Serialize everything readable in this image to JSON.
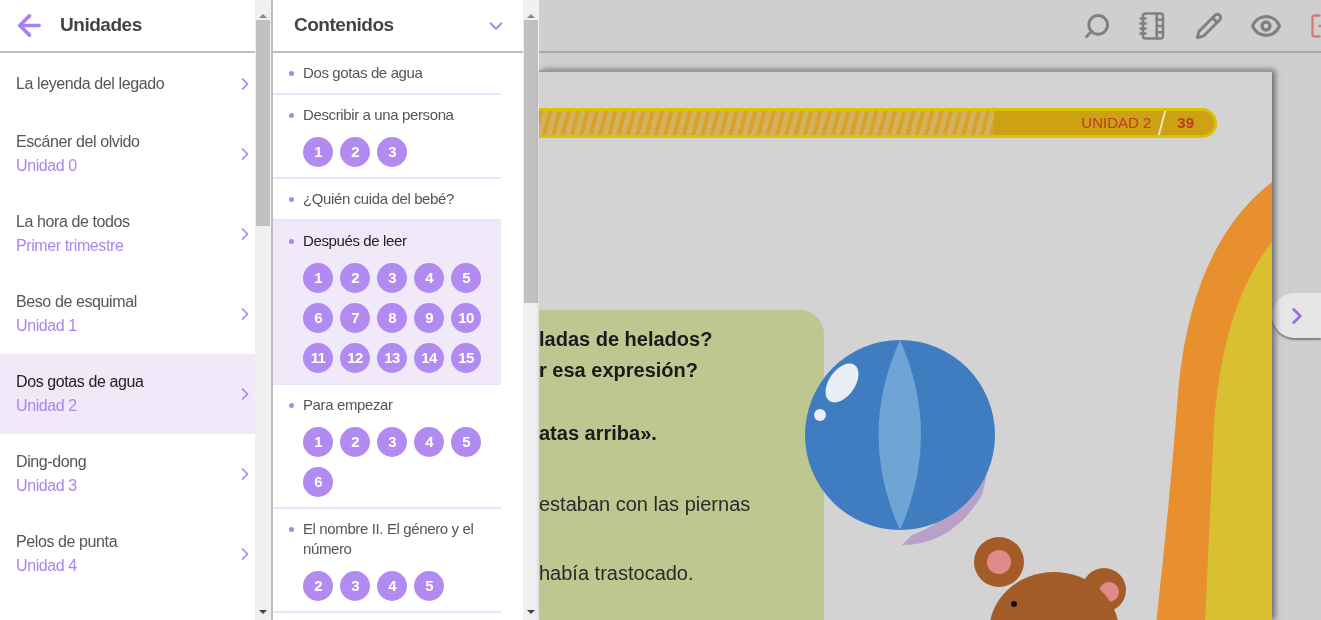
{
  "units": {
    "title": "Unidades",
    "items": [
      {
        "title": "La leyenda del legado",
        "selected": false
      },
      {
        "title": "Escáner del olvido",
        "subtitle": "Unidad 0",
        "selected": false
      },
      {
        "title": "La hora de todos",
        "subtitle": "Primer trimestre",
        "selected": false
      },
      {
        "title": "Beso de esquimal",
        "subtitle": "Unidad 1",
        "selected": false
      },
      {
        "title": "Dos gotas de agua",
        "subtitle": "Unidad 2",
        "selected": true
      },
      {
        "title": "Ding-dong",
        "subtitle": "Unidad 3",
        "selected": false
      },
      {
        "title": "Pelos de punta",
        "subtitle": "Unidad 4",
        "selected": false
      }
    ]
  },
  "contents": {
    "title": "Contenidos",
    "sections": [
      {
        "title": "Dos gotas de agua",
        "selected": false
      },
      {
        "title": "Describir a una persona",
        "selected": false,
        "pages": [
          "1",
          "2",
          "3"
        ]
      },
      {
        "title": "¿Quién cuida del bebé?",
        "selected": false
      },
      {
        "title": "Después de leer",
        "selected": true,
        "pages": [
          "1",
          "2",
          "3",
          "4",
          "5",
          "6",
          "7",
          "8",
          "9",
          "10",
          "11",
          "12",
          "13",
          "14",
          "15"
        ]
      },
      {
        "title": "Para empezar",
        "selected": false,
        "pages": [
          "1",
          "2",
          "3",
          "4",
          "5",
          "6"
        ]
      },
      {
        "title": "El nombre II. El género y el número",
        "selected": false,
        "pages": [
          "2",
          "3",
          "4",
          "5"
        ]
      }
    ]
  },
  "book": {
    "unit": "UNIDAD 2",
    "page": "39",
    "lines": [
      {
        "text": "ladas de helados?",
        "bold": true
      },
      {
        "text": "r esa expresión?",
        "bold": true
      },
      {
        "text": "atas arriba».",
        "bold": true
      },
      {
        "text": "estaban con las piernas",
        "bold": false
      },
      {
        "text": "había trastocado.",
        "bold": false
      }
    ]
  }
}
